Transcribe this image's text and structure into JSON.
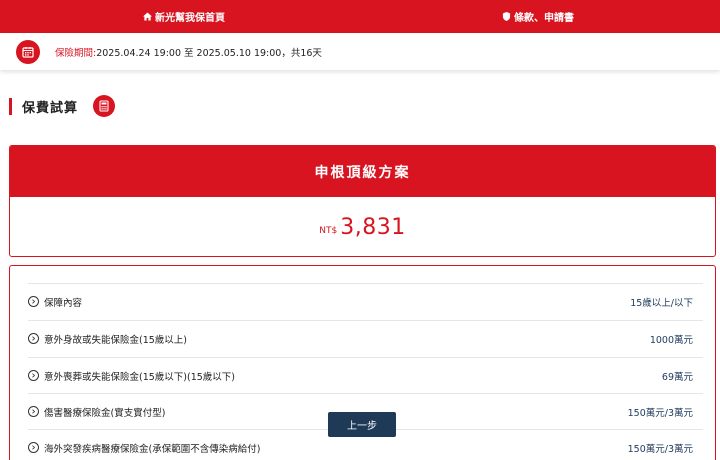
{
  "topbar": {
    "home_label": "新光幫我保首頁",
    "terms_label": "條款、申請書",
    "home_icon": "home-icon",
    "terms_icon": "shield-icon",
    "color": "#d7141f"
  },
  "period": {
    "label": "保險期間:",
    "text": "2025.04.24 19:00 至 2025.05.10 19:00，共16天",
    "icon": "calendar-icon"
  },
  "section": {
    "title": "保費試算",
    "icon": "calculator-icon"
  },
  "plan": {
    "name": "申根頂級方案",
    "currency": "NT$",
    "price": "3,831"
  },
  "coverage": [
    {
      "name": "保障內容",
      "value": "15歲以上/以下"
    },
    {
      "name": "意外身故或失能保險金(15歲以上)",
      "value": "1000萬元"
    },
    {
      "name": "意外喪葬或失能保險金(15歲以下)(15歲以下)",
      "value": "69萬元"
    },
    {
      "name": "傷害醫療保險金(實支實付型)",
      "value": "150萬元/3萬元"
    },
    {
      "name": "海外突發疾病醫療保險金(承保範圍不含傳染病給付)",
      "value": "150萬元/3萬元"
    }
  ],
  "buttons": {
    "prev_label": "上一步"
  },
  "colors": {
    "accent": "#d7141f",
    "value_text": "#1d3a5c",
    "button": "#1f3a56"
  }
}
